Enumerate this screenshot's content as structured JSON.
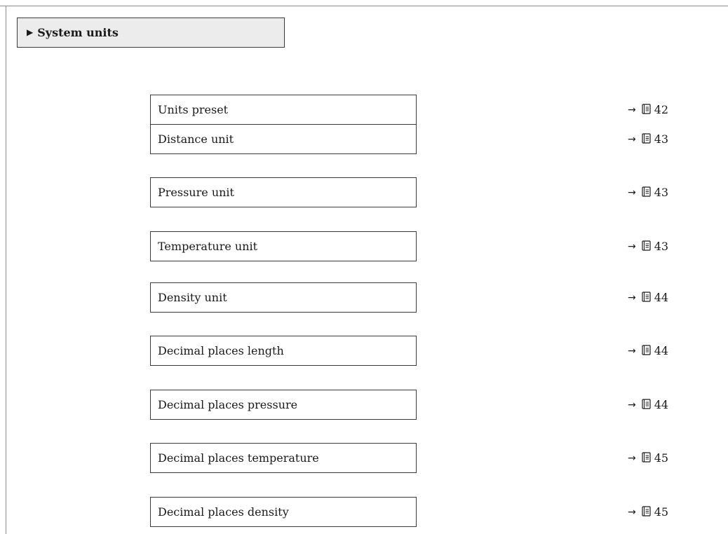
{
  "section": {
    "marker": "▶",
    "title": "System units"
  },
  "parameters": [
    {
      "label": "Units preset",
      "arrow": "→",
      "page": "42"
    },
    {
      "label": "Distance unit",
      "arrow": "→",
      "page": "43"
    },
    {
      "label": "Pressure unit",
      "arrow": "→",
      "page": "43"
    },
    {
      "label": "Temperature unit",
      "arrow": "→",
      "page": "43"
    },
    {
      "label": "Density unit",
      "arrow": "→",
      "page": "44"
    },
    {
      "label": "Decimal places length",
      "arrow": "→",
      "page": "44"
    },
    {
      "label": "Decimal places pressure",
      "arrow": "→",
      "page": "44"
    },
    {
      "label": "Decimal places temperature",
      "arrow": "→",
      "page": "45"
    },
    {
      "label": "Decimal places density",
      "arrow": "→",
      "page": "45"
    }
  ]
}
